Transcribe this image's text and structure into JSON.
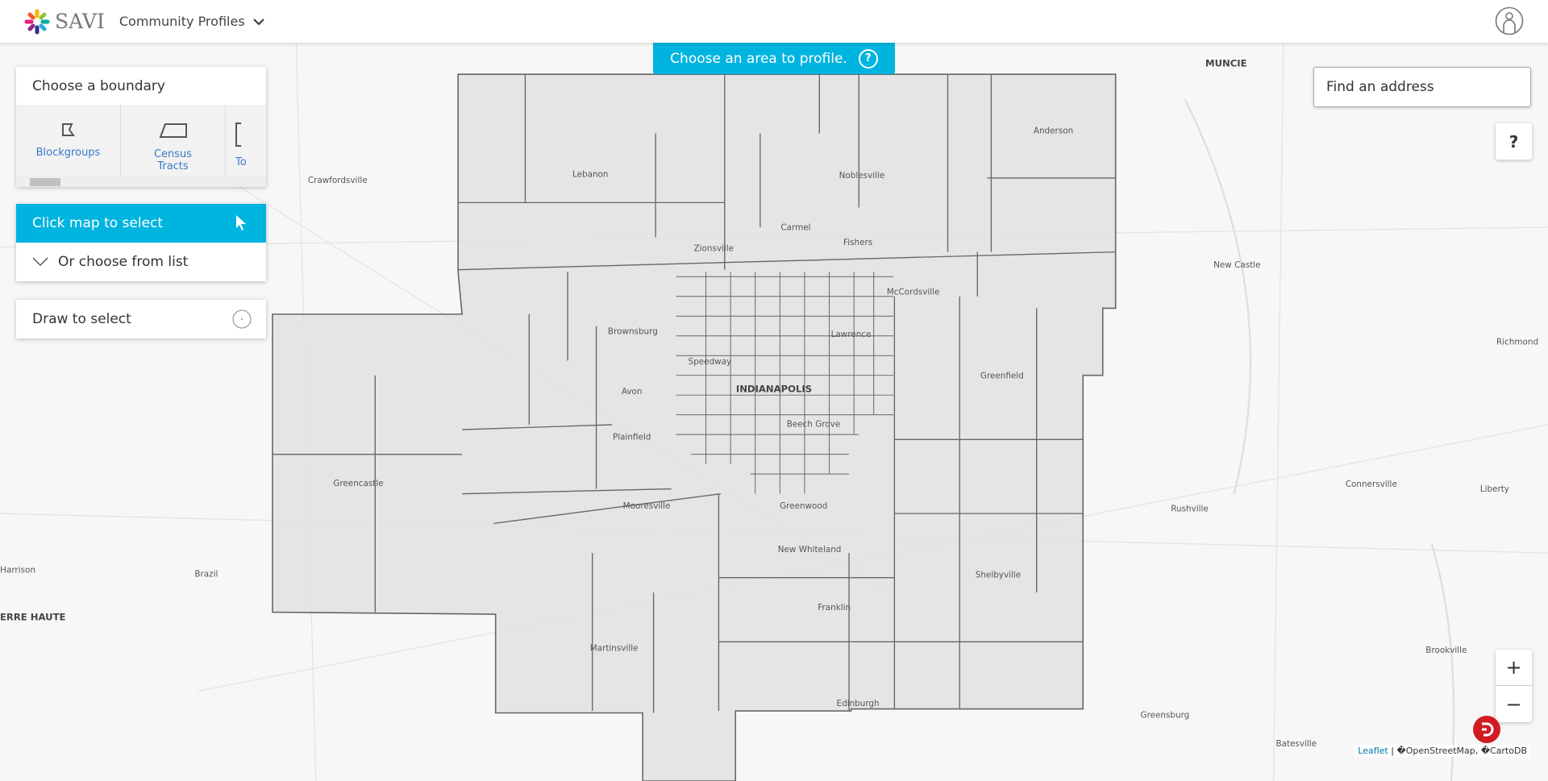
{
  "header": {
    "brand": "SAVI",
    "menu_label": "Community Profiles",
    "icons": [
      "savi-logo",
      "chevron-down-icon",
      "user-icon"
    ]
  },
  "banner": {
    "text": "Choose an area to profile.",
    "help": "?"
  },
  "boundary_panel": {
    "title": "Choose a boundary",
    "options": [
      {
        "label": "Blockgroups",
        "icon": "blockgroup-icon"
      },
      {
        "label": "Census Tracts",
        "icon": "tract-icon"
      },
      {
        "label": "To",
        "icon": "township-icon"
      }
    ]
  },
  "select_panel": {
    "click_label": "Click map to select",
    "list_label": "Or choose from list"
  },
  "draw_panel": {
    "label": "Draw to select"
  },
  "search": {
    "placeholder": "Find an address"
  },
  "help_button": "?",
  "zoom": {
    "in": "+",
    "out": "−"
  },
  "attribution": {
    "leaflet": "Leaflet",
    "sep": " | ",
    "rest": "�OpenStreetMap, �CartoDB"
  },
  "colors": {
    "accent": "#00b4e0",
    "region_fill": "#e2e2e2",
    "boundary": "#666666"
  },
  "map": {
    "labels": [
      {
        "name": "MUNCIE"
      },
      {
        "name": "Anderson"
      },
      {
        "name": "Lebanon"
      },
      {
        "name": "Noblesville"
      },
      {
        "name": "Crawfordsville"
      },
      {
        "name": "Carmel"
      },
      {
        "name": "Fishers"
      },
      {
        "name": "Zionsville"
      },
      {
        "name": "New Castle"
      },
      {
        "name": "McCordsville"
      },
      {
        "name": "Brownsburg"
      },
      {
        "name": "Lawrence"
      },
      {
        "name": "Richmond"
      },
      {
        "name": "Speedway"
      },
      {
        "name": "Greenfield"
      },
      {
        "name": "INDIANAPOLIS"
      },
      {
        "name": "Avon"
      },
      {
        "name": "Plainfield"
      },
      {
        "name": "Beech Grove"
      },
      {
        "name": "Greencastle"
      },
      {
        "name": "Connersville"
      },
      {
        "name": "Liberty"
      },
      {
        "name": "Mooresville"
      },
      {
        "name": "Greenwood"
      },
      {
        "name": "Rushville"
      },
      {
        "name": "New Whiteland"
      },
      {
        "name": "Harrison"
      },
      {
        "name": "Brazil"
      },
      {
        "name": "Shelbyville"
      },
      {
        "name": "Franklin"
      },
      {
        "name": "TERRE HAUTE"
      },
      {
        "name": "Martinsville"
      },
      {
        "name": "Brookville"
      },
      {
        "name": "Edinburgh"
      },
      {
        "name": "Greensburg"
      },
      {
        "name": "Batesville"
      }
    ]
  }
}
